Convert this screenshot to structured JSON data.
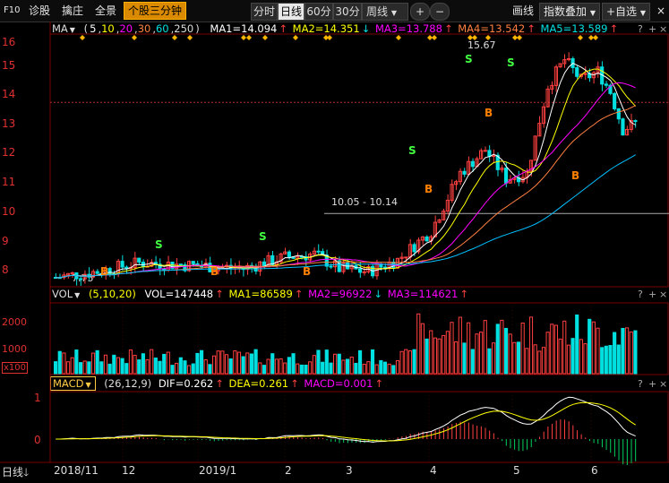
{
  "toolbar": {
    "f10": "F10",
    "diagnose": "诊股",
    "pick": "擒庄",
    "panorama": "全景",
    "stock_3min": "个股三分钟",
    "periods": [
      "分时",
      "日线",
      "60分",
      "30分",
      "周线"
    ],
    "selected_period": "日线",
    "plus": "+",
    "minus": "−",
    "draw_line": "画线",
    "index_overlay": "指数叠加",
    "add_watchlist": "+自选",
    "close": "×"
  },
  "ma_row": {
    "name": "MA",
    "params_open": "(",
    "p1": "5",
    "p2": "10",
    "p3": "20",
    "p4": "30",
    "p5": "60",
    "p6": "250",
    "params_close": ")",
    "ma1": "MA1=14.094",
    "ma2": "MA2=14.351",
    "ma3": "MA3=13.788",
    "ma4": "MA4=13.542",
    "ma5": "MA5=13.589",
    "arrows": [
      "↑",
      "↓",
      "↑",
      "↑",
      "↑"
    ],
    "help": "?",
    "more": "+",
    "close": "×"
  },
  "vol_row": {
    "name": "VOL",
    "params": "(5,10,20)",
    "vol": "VOL=147448",
    "ma1": "MA1=86589",
    "ma2": "MA2=96922",
    "ma3": "MA3=114621",
    "arrows": [
      "↑",
      "↑",
      "↓",
      "↑"
    ],
    "help": "?",
    "more": "+",
    "close": "×"
  },
  "macd_row": {
    "name": "MACD",
    "params": "(26,12,9)",
    "dif": "DIF=0.262",
    "dea": "DEA=0.261",
    "macd": "MACD=0.001",
    "arrows": [
      "↑",
      "↑",
      "↑"
    ],
    "help": "?",
    "more": "+",
    "close": "×"
  },
  "price_axis": [
    "16",
    "15",
    "14",
    "13",
    "12",
    "11",
    "10",
    "9",
    "8"
  ],
  "volume_axis": [
    "2000",
    "1000",
    "x100"
  ],
  "macd_axis": [
    "1",
    "0"
  ],
  "time_axis": [
    "2018/11",
    "12",
    "2019/1",
    "2",
    "3",
    "4",
    "5",
    "6"
  ],
  "bottom_tab": "日线",
  "annotations": {
    "high": "15.67",
    "low": "7.75",
    "range": "10.05 - 10.14"
  },
  "signals": {
    "buy": "B",
    "sell": "S"
  },
  "colors": {
    "up": "#ff4040",
    "down": "#00e0e0",
    "ma1": "#ffffff",
    "ma2": "#ffff00",
    "ma3": "#ff00ff",
    "ma4": "#ff8040",
    "ma5": "#00c0ff",
    "grid": "#7a0000",
    "accent": "#d98a00"
  }
}
